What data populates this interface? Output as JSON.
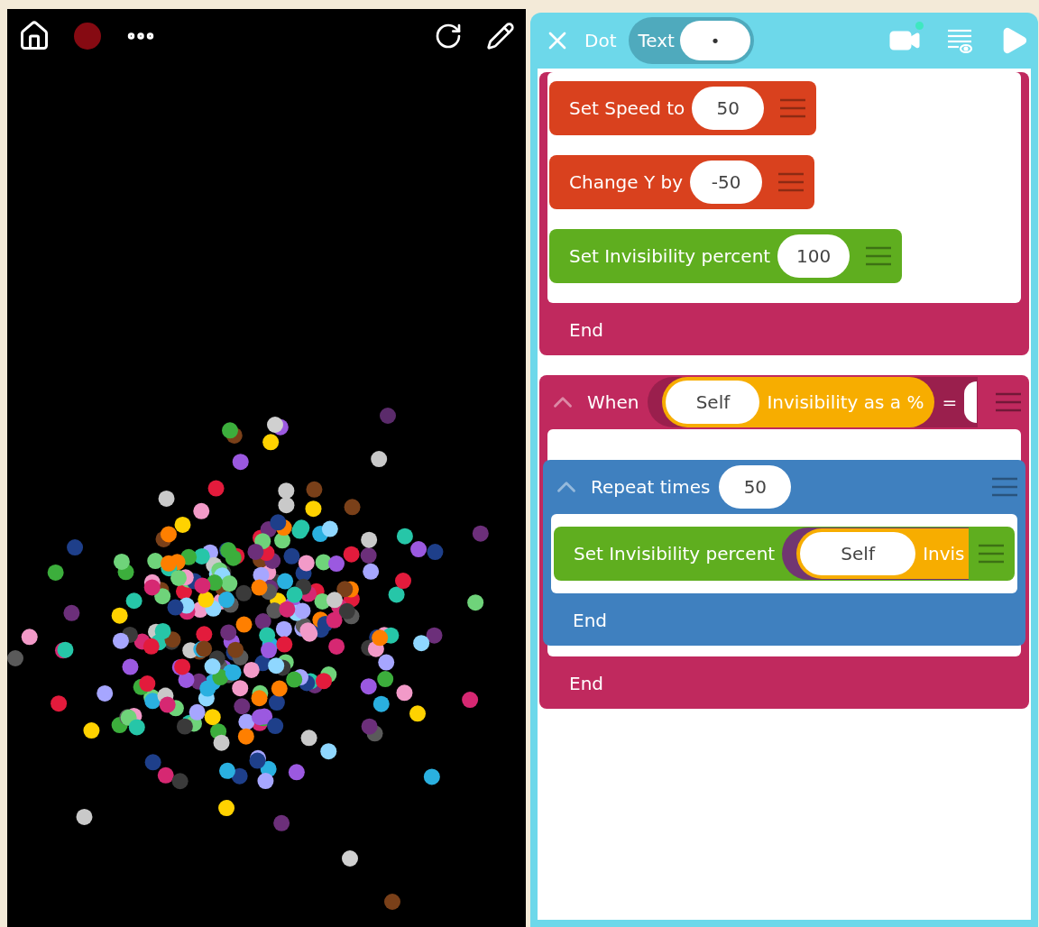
{
  "editor": {
    "object_name": "Dot",
    "text_label": "Text",
    "text_value": "•",
    "blocks": [
      {
        "kind": "event",
        "color": "#c0295e",
        "end": "End",
        "children": [
          {
            "kind": "action",
            "color": "#d9411e",
            "label": "Set Speed to",
            "value": "50"
          },
          {
            "kind": "action",
            "color": "#d9411e",
            "label": "Change Y by",
            "value": "-50"
          },
          {
            "kind": "action",
            "color": "#5fae1f",
            "label": "Set Invisibility percent",
            "value": "100"
          }
        ]
      },
      {
        "kind": "event",
        "color": "#c0295e",
        "label": "When",
        "expanded": true,
        "condition": {
          "object": "Self",
          "property": "Invisibility as a %",
          "operator": "="
        },
        "end": "End",
        "children": [
          {
            "kind": "repeat",
            "color": "#3f80bf",
            "label": "Repeat times",
            "value": "50",
            "expanded": true,
            "end": "End",
            "children": [
              {
                "kind": "reporter_action",
                "color": "#5fae1f",
                "label": "Set Invisibility percent",
                "object": "Self",
                "property": "Invis"
              }
            ]
          }
        ]
      }
    ]
  }
}
